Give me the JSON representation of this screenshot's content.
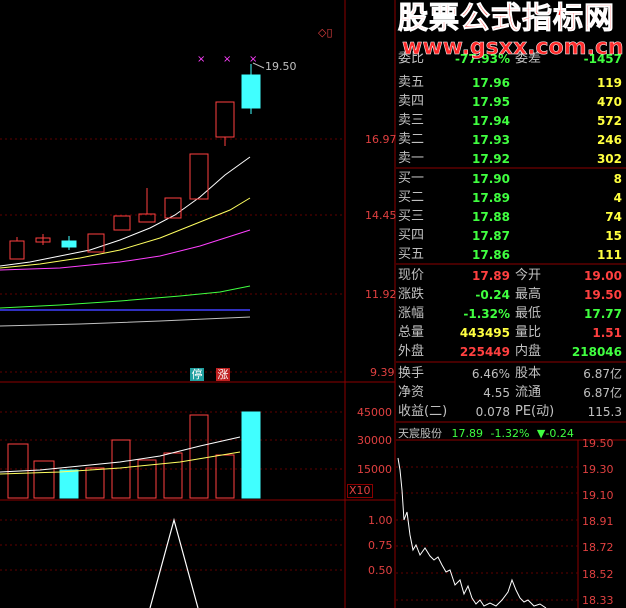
{
  "watermark": {
    "title": "股票公式指标网",
    "url": "www.gsxx.com.cn"
  },
  "main_chart": {
    "price_annotation": "19.50",
    "y_axis_labels": [
      "16.97",
      "14.45",
      "11.92",
      "9.39"
    ],
    "tags": {
      "ting": "停",
      "zhang": "涨"
    },
    "icon_label": "◇▯"
  },
  "volume_chart": {
    "y_axis_labels": [
      "45000",
      "30000",
      "15000"
    ],
    "multiplier": "X10"
  },
  "indicator_chart": {
    "y_axis_labels": [
      "1.00",
      "0.75",
      "0.50"
    ]
  },
  "order_book": {
    "top_row": {
      "left_label": "委比",
      "left_value": "-77.93%",
      "right_label": "委差",
      "right_value": "-1457"
    },
    "sell": [
      {
        "label": "卖五",
        "price": "17.96",
        "vol": "119"
      },
      {
        "label": "卖四",
        "price": "17.95",
        "vol": "470"
      },
      {
        "label": "卖三",
        "price": "17.94",
        "vol": "572"
      },
      {
        "label": "卖二",
        "price": "17.93",
        "vol": "246"
      },
      {
        "label": "卖一",
        "price": "17.92",
        "vol": "302"
      }
    ],
    "buy": [
      {
        "label": "买一",
        "price": "17.90",
        "vol": "8"
      },
      {
        "label": "买二",
        "price": "17.89",
        "vol": "4"
      },
      {
        "label": "买三",
        "price": "17.88",
        "vol": "74"
      },
      {
        "label": "买四",
        "price": "17.87",
        "vol": "15"
      },
      {
        "label": "买五",
        "price": "17.86",
        "vol": "111"
      }
    ]
  },
  "quote": [
    {
      "l1": "现价",
      "v1": "17.89",
      "c1": "#ff4040",
      "l2": "今开",
      "v2": "19.00",
      "c2": "#ff4040"
    },
    {
      "l1": "涨跌",
      "v1": "-0.24",
      "c1": "#40ff40",
      "l2": "最高",
      "v2": "19.50",
      "c2": "#ff4040"
    },
    {
      "l1": "涨幅",
      "v1": "-1.32%",
      "c1": "#40ff40",
      "l2": "最低",
      "v2": "17.77",
      "c2": "#40ff40"
    },
    {
      "l1": "总量",
      "v1": "443495",
      "c1": "#ffff40",
      "l2": "量比",
      "v2": "1.51",
      "c2": "#ff4040"
    },
    {
      "l1": "外盘",
      "v1": "225449",
      "c1": "#ff4040",
      "l2": "内盘",
      "v2": "218046",
      "c2": "#40ff40"
    }
  ],
  "fundamentals": [
    {
      "l1": "换手",
      "v1": "6.46%",
      "l2": "股本",
      "v2": "6.87亿"
    },
    {
      "l1": "净资",
      "v1": "4.55",
      "l2": "流通",
      "v2": "6.87亿"
    },
    {
      "l1": "收益(二)",
      "v1": "0.078",
      "l2": "PE(动)",
      "v2": "115.3"
    }
  ],
  "mini_chart": {
    "name": "天宸股份",
    "price": "17.89",
    "pct": "-1.32%",
    "change": "▼-0.24",
    "y_axis_labels": [
      "19.50",
      "19.30",
      "19.10",
      "18.91",
      "18.72",
      "18.52",
      "18.33"
    ]
  }
}
